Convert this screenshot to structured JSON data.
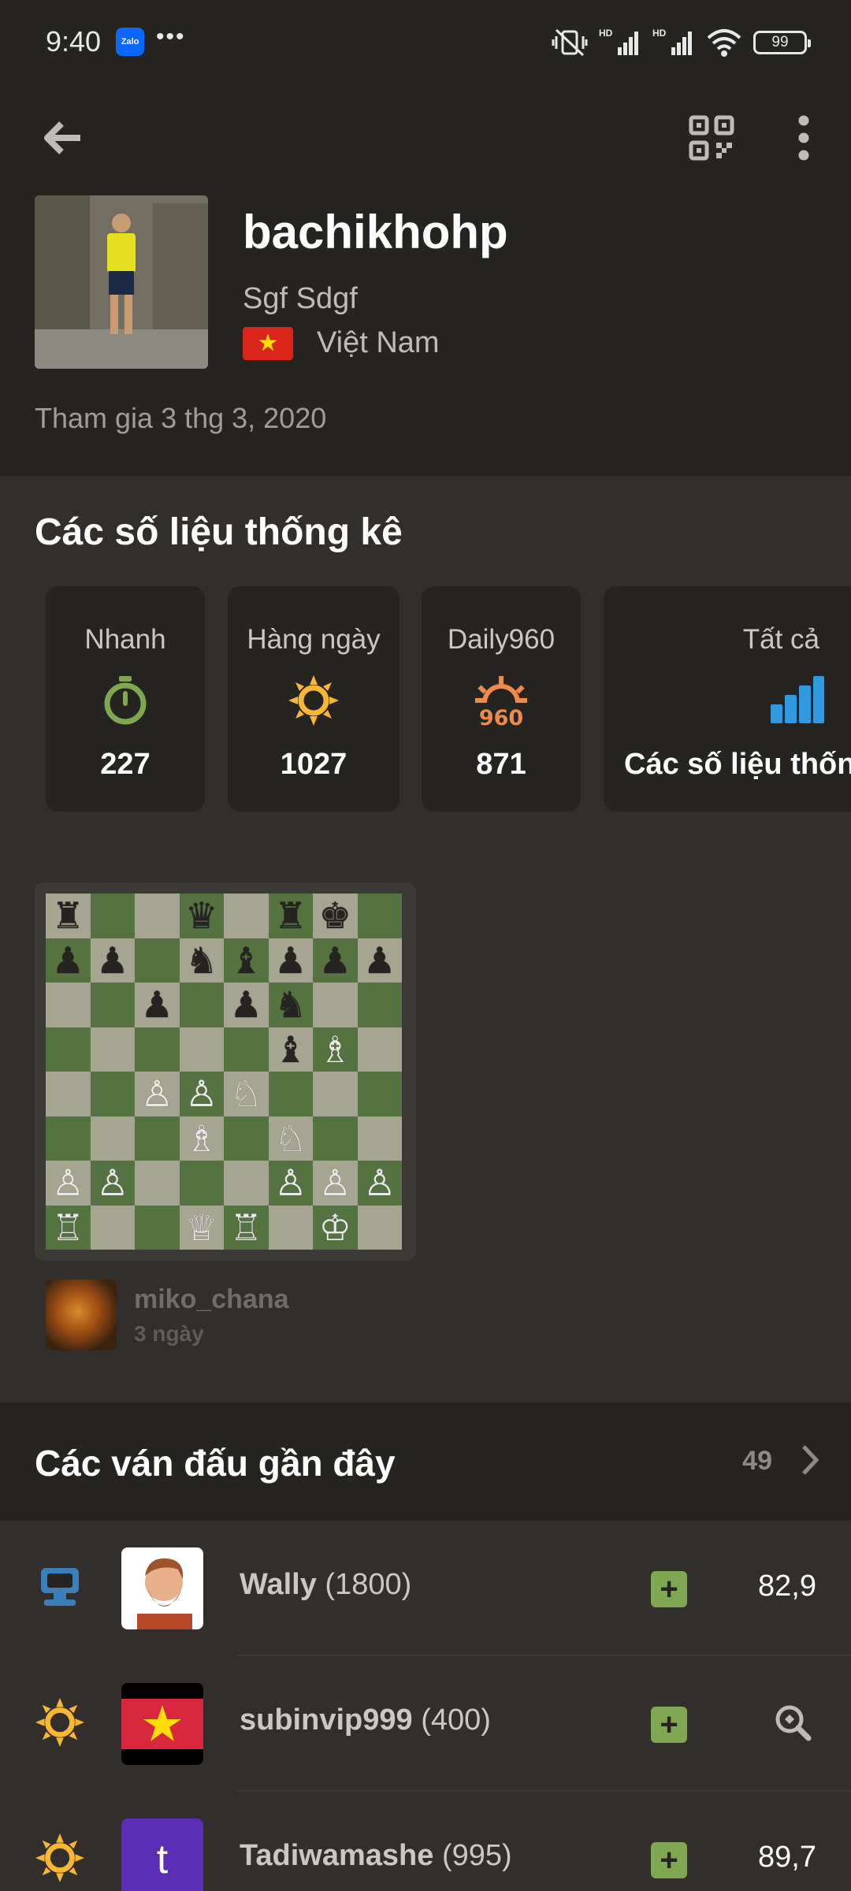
{
  "status_bar": {
    "time": "9:40",
    "zalo_label": "Zalo",
    "battery": "99"
  },
  "profile": {
    "username": "bachikhohp",
    "real_name": "Sgf Sdgf",
    "country": "Việt Nam",
    "flag_star": "★",
    "joined": "Tham gia 3 thg 3, 2020"
  },
  "stats": {
    "title": "Các số liệu thống kê",
    "cards": [
      {
        "label": "Nhanh",
        "value": "227",
        "icon": "stopwatch-icon",
        "color": "#7fa650"
      },
      {
        "label": "Hàng ngày",
        "value": "1027",
        "icon": "sun-icon",
        "color": "#f7b733"
      },
      {
        "label": "Daily960",
        "value": "871",
        "icon": "daily960-icon",
        "color": "#f08a4b"
      },
      {
        "label": "Tất cả",
        "value": "Các số liệu thống kê",
        "icon": "bar-chart-icon",
        "color": "#2f9ae0"
      }
    ]
  },
  "board": {
    "rows": [
      [
        "♜",
        "",
        "",
        "♛",
        "",
        "♜",
        "♚",
        ""
      ],
      [
        "♟",
        "♟",
        "",
        "♞",
        "♝",
        "♟",
        "♟",
        "♟"
      ],
      [
        "",
        "",
        "♟",
        "",
        "♟",
        "♞",
        "",
        ""
      ],
      [
        "",
        "",
        "",
        "",
        "",
        "♝",
        "♗",
        ""
      ],
      [
        "",
        "",
        "♙",
        "♙",
        "♘",
        "",
        "",
        ""
      ],
      [
        "",
        "",
        "",
        "♗",
        "",
        "♘",
        "",
        ""
      ],
      [
        "♙",
        "♙",
        "",
        "",
        "",
        "♙",
        "♙",
        "♙"
      ],
      [
        "♖",
        "",
        "",
        "♕",
        "♖",
        "",
        "♔",
        ""
      ]
    ]
  },
  "daily_game": {
    "opponent": "miko_chana",
    "time": "3 ngày"
  },
  "recent_games": {
    "title": "Các ván đấu gần đây",
    "count": "49",
    "rows": [
      {
        "type_icon": "computer-icon",
        "name": "Wally",
        "rating": "(1800)",
        "result": "+",
        "accuracy": "82,9",
        "avatar_letter": ""
      },
      {
        "type_icon": "sun-icon",
        "name": "subinvip999",
        "rating": "(400)",
        "result": "+",
        "accuracy": "",
        "avatar_letter": ""
      },
      {
        "type_icon": "sun-icon",
        "name": "Tadiwamashe",
        "rating": "(995)",
        "result": "+",
        "accuracy": "89,7",
        "avatar_letter": "t"
      }
    ]
  }
}
